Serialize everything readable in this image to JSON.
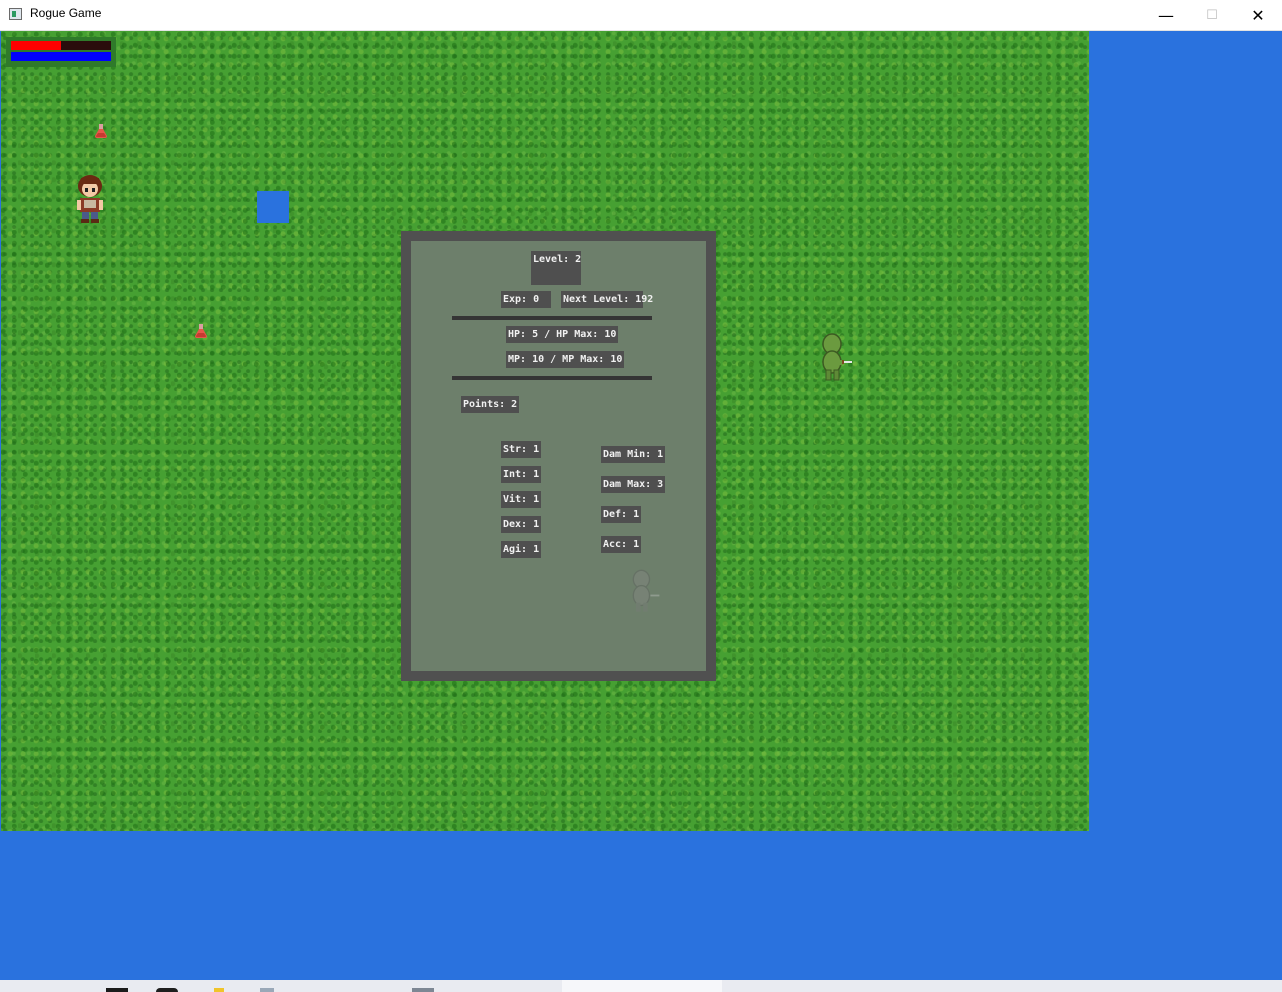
{
  "window": {
    "title": "Rogue Game",
    "minimize_glyph": "—",
    "maximize_glyph": "☐",
    "close_glyph": "✕",
    "icon": "app-window-icon"
  },
  "hud": {
    "hp_fraction": 0.5,
    "mp_fraction": 1.0,
    "hp_color": "#ff0000",
    "mp_color": "#0000ff"
  },
  "world": {
    "grass_color": "#46a032",
    "water_color": "#2a72de",
    "entities": [
      "player-sprite",
      "potion-icon",
      "potion-icon",
      "orc-enemy-sprite",
      "blue-tile"
    ]
  },
  "stats": {
    "level": "Level: 2",
    "exp": "Exp: 0",
    "next_level": "Next Level: 192",
    "hp": "HP: 5 / HP Max: 10",
    "mp": "MP: 10 / MP Max: 10",
    "points": "Points: 2",
    "attributes": {
      "str": "Str: 1",
      "int": "Int: 1",
      "vit": "Vit: 1",
      "dex": "Dex: 1",
      "agi": "Agi: 1"
    },
    "derived": {
      "dam_min": "Dam Min: 1",
      "dam_max": "Dam Max: 3",
      "def": "Def: 1",
      "acc": "Acc: 1"
    }
  }
}
